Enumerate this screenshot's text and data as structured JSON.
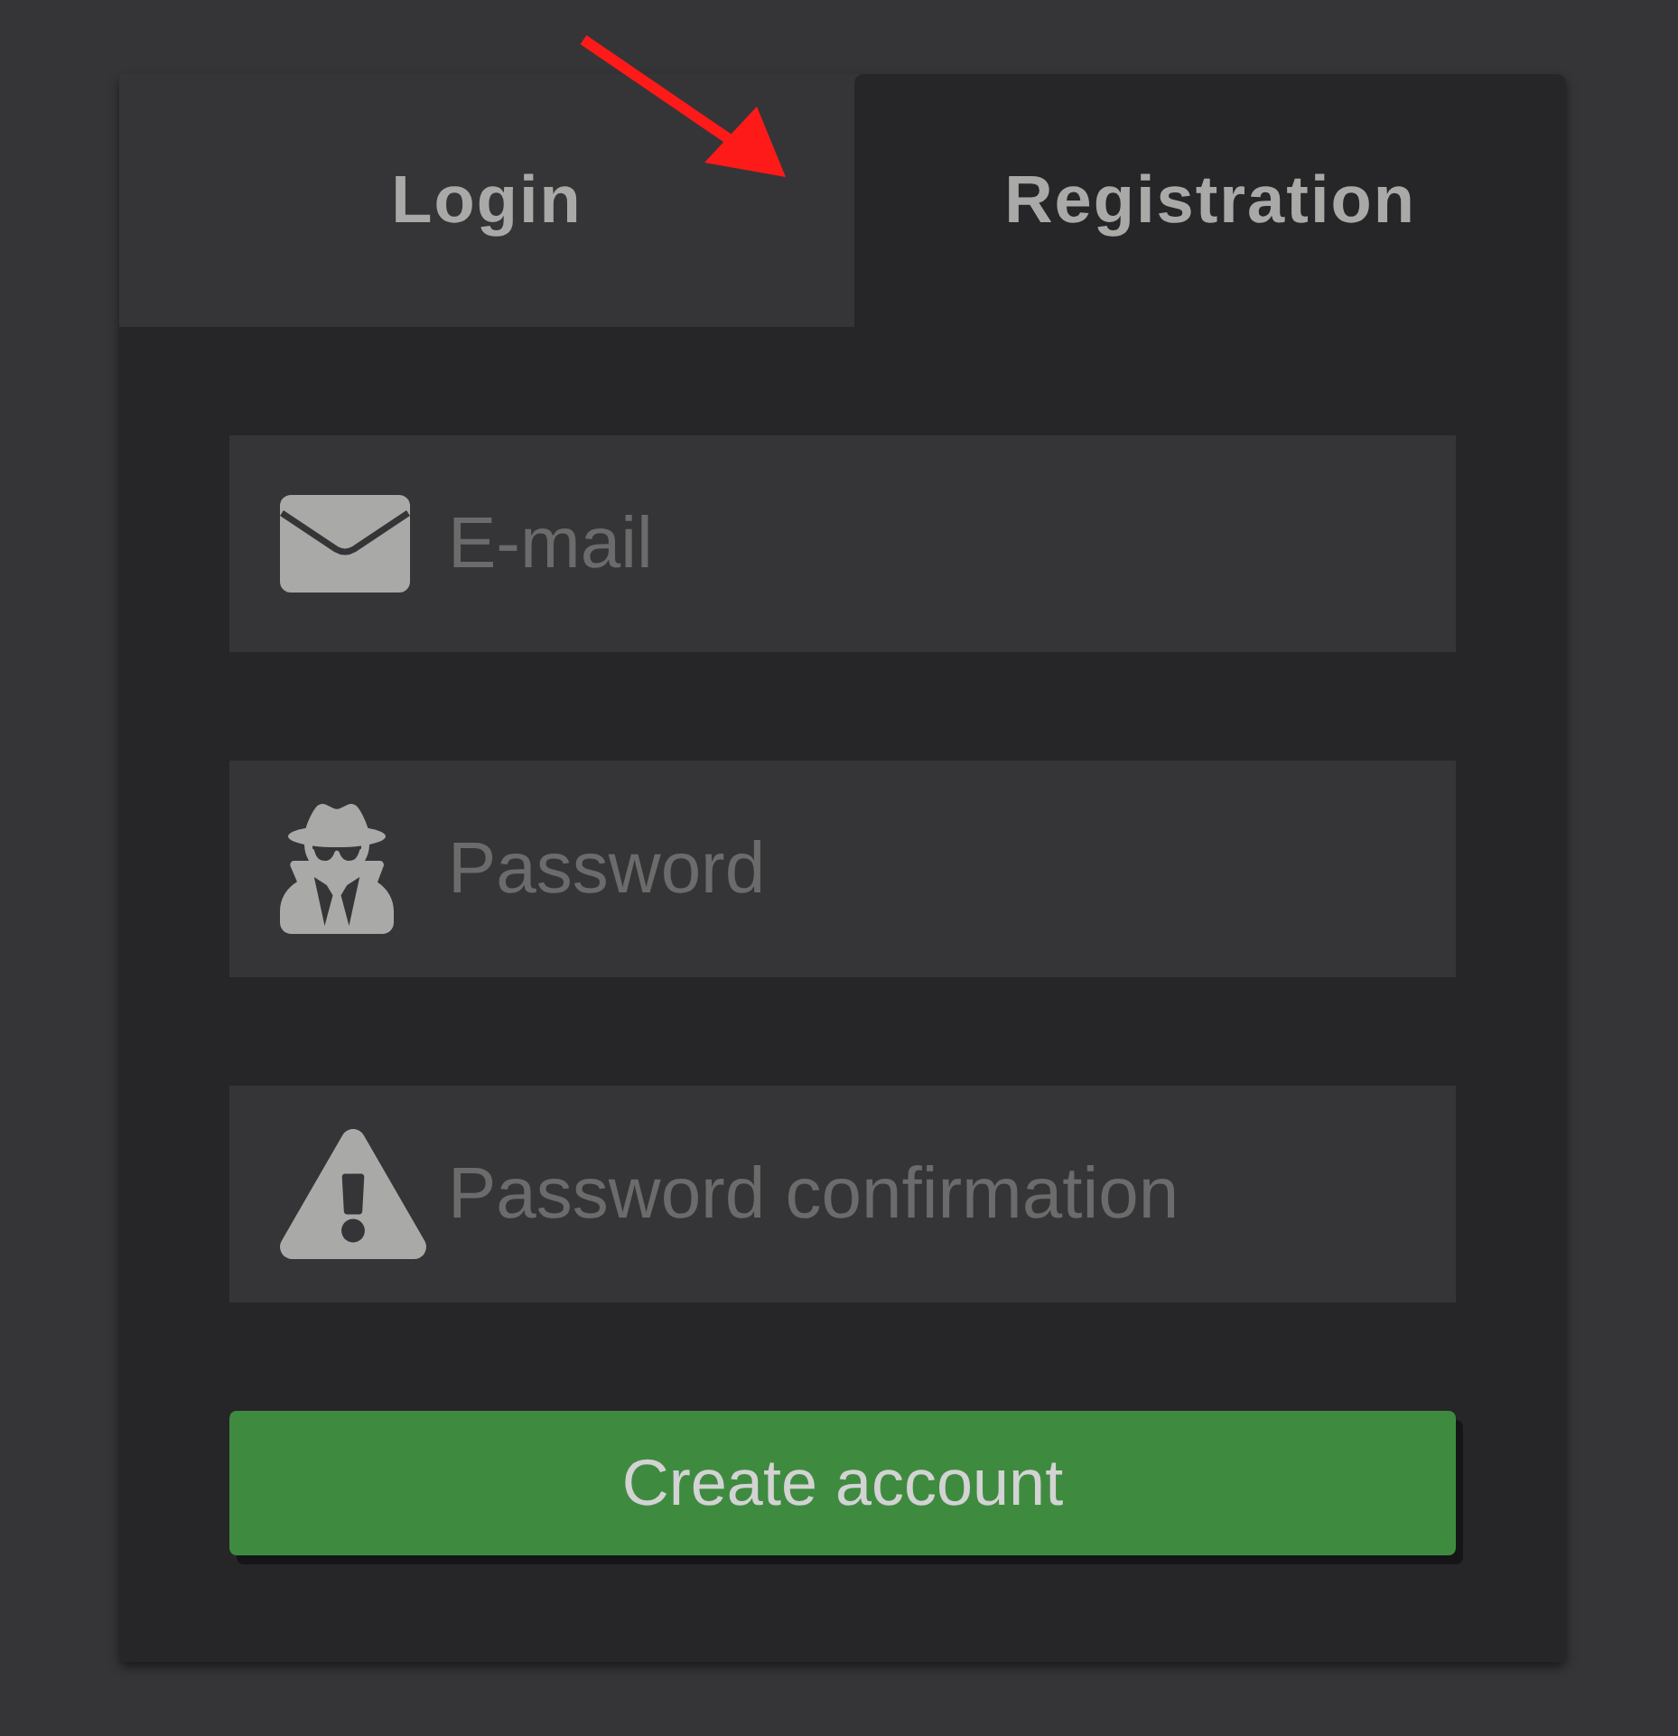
{
  "tabs": [
    {
      "label": "Login",
      "selected": false
    },
    {
      "label": "Registration",
      "selected": true
    }
  ],
  "fields": [
    {
      "kind": "email",
      "placeholder": "E-mail"
    },
    {
      "kind": "password",
      "placeholder": "Password"
    },
    {
      "kind": "confirmation",
      "placeholder": "Password confirmation"
    }
  ],
  "submit_button": {
    "label": "Create account"
  }
}
